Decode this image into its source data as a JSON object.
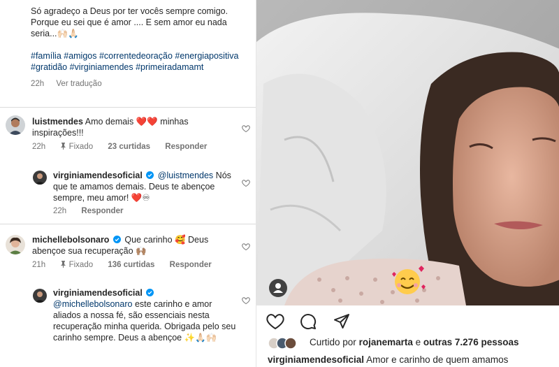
{
  "caption": {
    "text": "Só agradeço a Deus por ter vocês sempre comigo. Porque eu sei que é amor .... E sem amor eu nada seria...🙌🏻🙏🏻",
    "hashtags": "#família #amigos #correntedeoração #energiapositiva #gratidão #virginiamendes #primeiradamamt",
    "time": "22h",
    "translate": "Ver tradução"
  },
  "comments": [
    {
      "username": "luistmendes",
      "text": "Amo demais ❤️❤️ minhas inspirações!!!",
      "time": "22h",
      "pinned": "Fixado",
      "likes": "23 curtidas",
      "reply": "Responder"
    },
    {
      "username": "virginiamendesoficial",
      "mention": "@luistmendes",
      "text": "Nós que te amamos demais. Deus te abençoe sempre, meu amor! ❤️♾",
      "time": "22h",
      "reply": "Responder"
    },
    {
      "username": "michellebolsonaro",
      "text": "Que carinho 🥰 Deus abençoe sua recuperação 🙌🏽",
      "time": "21h",
      "pinned": "Fixado",
      "likes": "136 curtidas",
      "reply": "Responder"
    },
    {
      "username": "virginiamendesoficial",
      "mention": "@michellebolsonaro",
      "text": "este carinho e amor aliados a nossa fé, são essenciais nesta recuperação minha querida. Obrigada pelo seu carinho sempre. Deus a abençoe ✨🙏🏻🙌🏻"
    }
  ],
  "post": {
    "liked_prefix": "Curtido por",
    "liked_user": "rojanemarta",
    "liked_mid": "e",
    "liked_others": "outras 7.276 pessoas",
    "caption_user": "virginiamendesoficial",
    "caption_text": "Amor e carinho de quem amamos"
  },
  "colors": {
    "link": "#00376b",
    "verified": "#0095f6",
    "heart": "#ed4956",
    "muted": "#737373"
  },
  "icons": [
    "heart-icon",
    "comment-icon",
    "share-icon",
    "verified-badge-icon",
    "tagged-user-icon",
    "pin-icon"
  ]
}
